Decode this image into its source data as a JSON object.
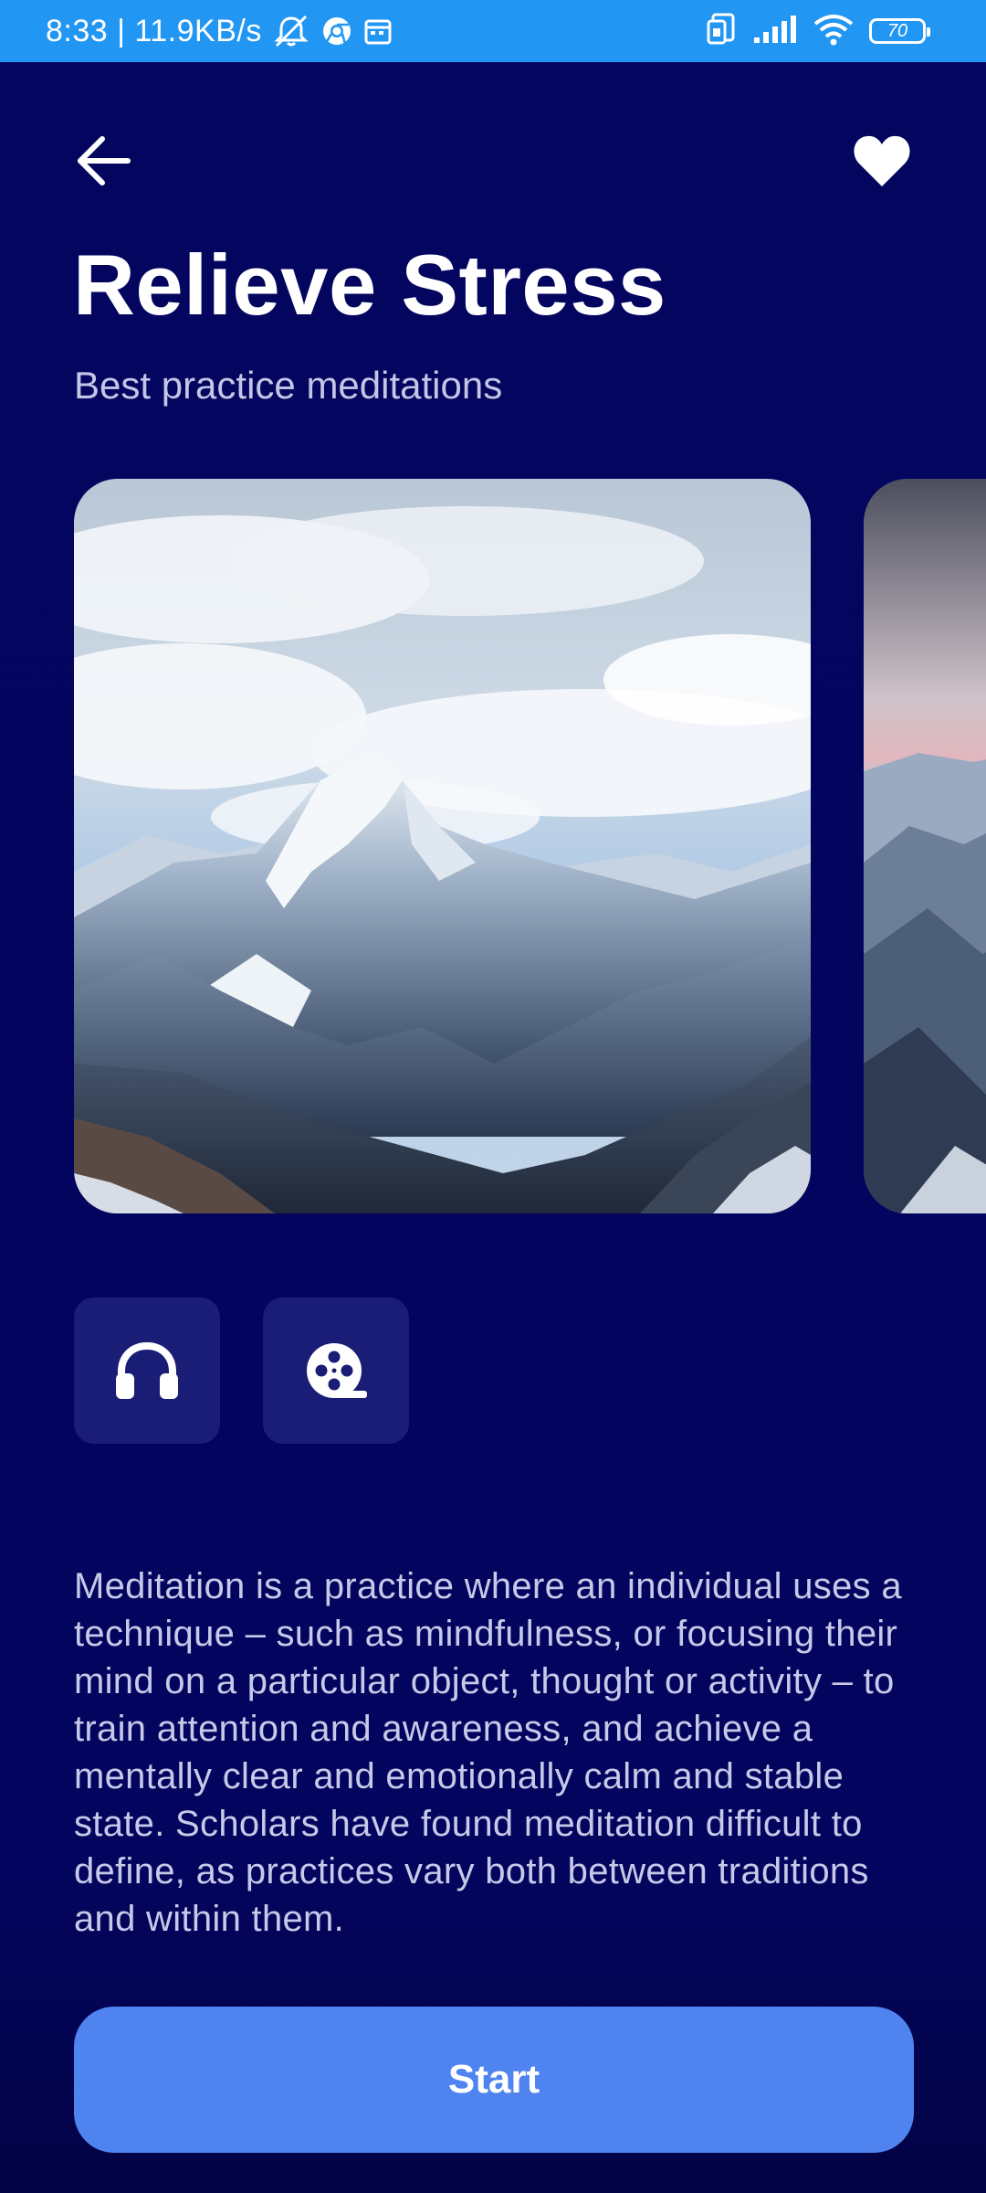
{
  "status_bar": {
    "text": "8:33 | 11.9KB/s",
    "battery": "70",
    "icons": [
      "mute-icon",
      "chrome-icon",
      "calendar-icon",
      "sim-icon",
      "signal-icon",
      "wifi-icon",
      "battery-icon"
    ]
  },
  "header": {
    "back_icon": "arrow-left-icon",
    "favorite_icon": "heart-icon",
    "title": "Relieve Stress",
    "subtitle": "Best practice meditations"
  },
  "carousel": {
    "images": [
      {
        "subject": "snowy mountain peak under cloudy sky"
      },
      {
        "subject": "mountain range at pink dusk (partially visible)"
      }
    ]
  },
  "media_options": [
    {
      "icon": "headphones-icon",
      "kind": "audio"
    },
    {
      "icon": "film-reel-icon",
      "kind": "video"
    }
  ],
  "description": "Meditation is a practice where an individual uses a technique – such as mindfulness, or focusing their mind on a particular object, thought or activity – to train attention and awareness, and achieve a mentally clear and emotionally calm and stable state. Scholars have found meditation difficult to define, as practices vary both between traditions and within them.",
  "start_button": {
    "label": "Start"
  },
  "colors": {
    "background": "#03045e",
    "status_bar": "#2196f3",
    "media_button_bg": "#1a1d75",
    "accent": "#4f84f0",
    "text_primary": "#ffffff",
    "text_secondary": "#c6c9e8"
  }
}
